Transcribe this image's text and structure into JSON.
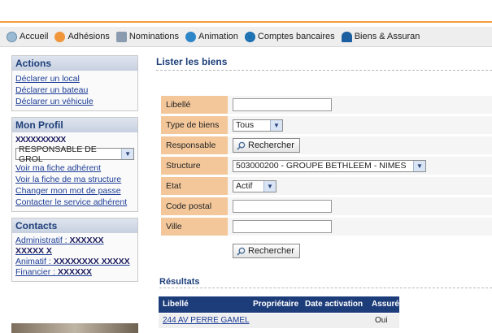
{
  "nav": [
    {
      "label": "Accueil",
      "icon": "home-icon"
    },
    {
      "label": "Adhésions",
      "icon": "users-icon"
    },
    {
      "label": "Nominations",
      "icon": "people-icon"
    },
    {
      "label": "Animation",
      "icon": "group-icon"
    },
    {
      "label": "Comptes bancaires",
      "icon": "coin-icon"
    },
    {
      "label": "Biens & Assuran",
      "icon": "umbrella-icon"
    }
  ],
  "sidebar": {
    "actions": {
      "title": "Actions",
      "links": [
        "Déclarer un local",
        "Déclarer un bateau",
        "Déclarer un véhicule"
      ]
    },
    "profile": {
      "title": "Mon Profil",
      "masked_name": "XXXXXXXXXX",
      "role_select": "RESPONSABLE DE GROL",
      "links": [
        "Voir ma fiche adhérent",
        "Voir la fiche de ma structure",
        "Changer mon mot de passe",
        "Contacter le service adhérent"
      ]
    },
    "contacts": {
      "title": "Contacts",
      "lines": [
        {
          "label": "Administratif :",
          "value": "XXXXXX XXXXX X"
        },
        {
          "label": "Animatif :",
          "value": "XXXXXXXX XXXXX"
        },
        {
          "label": "Financier :",
          "value": "XXXXXX"
        }
      ]
    }
  },
  "main": {
    "title": "Lister les biens",
    "form": {
      "libelle_label": "Libellé",
      "libelle_value": "",
      "type_label": "Type de biens",
      "type_value": "Tous",
      "responsable_label": "Responsable",
      "search_button": "Rechercher",
      "structure_label": "Structure",
      "structure_value": "503000200 - GROUPE BETHLEEM - NIMES",
      "etat_label": "Etat",
      "etat_value": "Actif",
      "postal_label": "Code postal",
      "postal_value": "",
      "ville_label": "Ville",
      "ville_value": "",
      "submit_button": "Rechercher"
    },
    "results": {
      "title": "Résultats",
      "headers": [
        "Libellé",
        "Propriétaire",
        "Date activation",
        "Assuré"
      ],
      "rows": [
        {
          "libelle": "244 AV PERRE GAMEL",
          "proprietaire": "",
          "date": "",
          "assure": "Oui"
        }
      ]
    }
  }
}
